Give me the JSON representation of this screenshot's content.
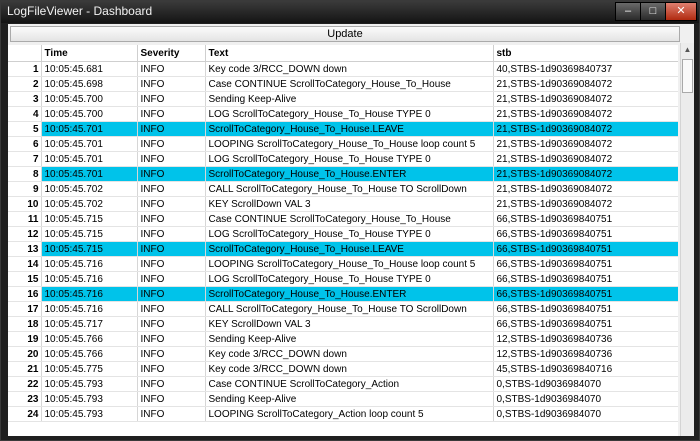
{
  "window": {
    "title": "LogFileViewer - Dashboard",
    "min_glyph": "–",
    "max_glyph": "□",
    "close_glyph": "✕"
  },
  "toolbar": {
    "update_label": "Update"
  },
  "columns": [
    "",
    "Time",
    "Severity",
    "Text",
    "stb"
  ],
  "highlight_color": "#00c3ea",
  "rows": [
    {
      "n": "1",
      "time": "10:05:45.681",
      "sev": "INFO",
      "text": "Key code 3/RCC_DOWN down",
      "stb": "40,STBS-1d90369840737",
      "hl": false
    },
    {
      "n": "2",
      "time": "10:05:45.698",
      "sev": "INFO",
      "text": "Case CONTINUE ScrollToCategory_House_To_House",
      "stb": "21,STBS-1d90369084072",
      "hl": false
    },
    {
      "n": "3",
      "time": "10:05:45.700",
      "sev": "INFO",
      "text": "Sending Keep-Alive",
      "stb": "21,STBS-1d90369084072",
      "hl": false
    },
    {
      "n": "4",
      "time": "10:05:45.700",
      "sev": "INFO",
      "text": "LOG ScrollToCategory_House_To_House TYPE 0",
      "stb": "21,STBS-1d90369084072",
      "hl": false
    },
    {
      "n": "5",
      "time": "10:05:45.701",
      "sev": "INFO",
      "text": "ScrollToCategory_House_To_House.LEAVE",
      "stb": "21,STBS-1d90369084072",
      "hl": true
    },
    {
      "n": "6",
      "time": "10:05:45.701",
      "sev": "INFO",
      "text": "LOOPING ScrollToCategory_House_To_House loop count 5",
      "stb": "21,STBS-1d90369084072",
      "hl": false
    },
    {
      "n": "7",
      "time": "10:05:45.701",
      "sev": "INFO",
      "text": "LOG ScrollToCategory_House_To_House TYPE 0",
      "stb": "21,STBS-1d90369084072",
      "hl": false
    },
    {
      "n": "8",
      "time": "10:05:45.701",
      "sev": "INFO",
      "text": "ScrollToCategory_House_To_House.ENTER",
      "stb": "21,STBS-1d90369084072",
      "hl": true
    },
    {
      "n": "9",
      "time": "10:05:45.702",
      "sev": "INFO",
      "text": "CALL ScrollToCategory_House_To_House TO ScrollDown",
      "stb": "21,STBS-1d90369084072",
      "hl": false
    },
    {
      "n": "10",
      "time": "10:05:45.702",
      "sev": "INFO",
      "text": "KEY ScrollDown VAL 3",
      "stb": "21,STBS-1d90369084072",
      "hl": false
    },
    {
      "n": "11",
      "time": "10:05:45.715",
      "sev": "INFO",
      "text": "Case CONTINUE ScrollToCategory_House_To_House",
      "stb": "66,STBS-1d90369840751",
      "hl": false
    },
    {
      "n": "12",
      "time": "10:05:45.715",
      "sev": "INFO",
      "text": "LOG ScrollToCategory_House_To_House TYPE 0",
      "stb": "66,STBS-1d90369840751",
      "hl": false
    },
    {
      "n": "13",
      "time": "10:05:45.715",
      "sev": "INFO",
      "text": "ScrollToCategory_House_To_House.LEAVE",
      "stb": "66,STBS-1d90369840751",
      "hl": true
    },
    {
      "n": "14",
      "time": "10:05:45.716",
      "sev": "INFO",
      "text": "LOOPING ScrollToCategory_House_To_House loop count 5",
      "stb": "66,STBS-1d90369840751",
      "hl": false
    },
    {
      "n": "15",
      "time": "10:05:45.716",
      "sev": "INFO",
      "text": "LOG ScrollToCategory_House_To_House TYPE 0",
      "stb": "66,STBS-1d90369840751",
      "hl": false
    },
    {
      "n": "16",
      "time": "10:05:45.716",
      "sev": "INFO",
      "text": "ScrollToCategory_House_To_House.ENTER",
      "stb": "66,STBS-1d90369840751",
      "hl": true
    },
    {
      "n": "17",
      "time": "10:05:45.716",
      "sev": "INFO",
      "text": "CALL ScrollToCategory_House_To_House TO ScrollDown",
      "stb": "66,STBS-1d90369840751",
      "hl": false
    },
    {
      "n": "18",
      "time": "10:05:45.717",
      "sev": "INFO",
      "text": "KEY ScrollDown VAL 3",
      "stb": "66,STBS-1d90369840751",
      "hl": false
    },
    {
      "n": "19",
      "time": "10:05:45.766",
      "sev": "INFO",
      "text": "Sending Keep-Alive",
      "stb": "12,STBS-1d90369840736",
      "hl": false
    },
    {
      "n": "20",
      "time": "10:05:45.766",
      "sev": "INFO",
      "text": "Key code 3/RCC_DOWN down",
      "stb": "12,STBS-1d90369840736",
      "hl": false
    },
    {
      "n": "21",
      "time": "10:05:45.775",
      "sev": "INFO",
      "text": "Key code 3/RCC_DOWN down",
      "stb": "45,STBS-1d90369840716",
      "hl": false
    },
    {
      "n": "22",
      "time": "10:05:45.793",
      "sev": "INFO",
      "text": "Case CONTINUE ScrollToCategory_Action",
      "stb": "0,STBS-1d9036984070",
      "hl": false
    },
    {
      "n": "23",
      "time": "10:05:45.793",
      "sev": "INFO",
      "text": "Sending Keep-Alive",
      "stb": "0,STBS-1d9036984070",
      "hl": false
    },
    {
      "n": "24",
      "time": "10:05:45.793",
      "sev": "INFO",
      "text": "LOOPING ScrollToCategory_Action loop count 5",
      "stb": "0,STBS-1d9036984070",
      "hl": false
    }
  ]
}
